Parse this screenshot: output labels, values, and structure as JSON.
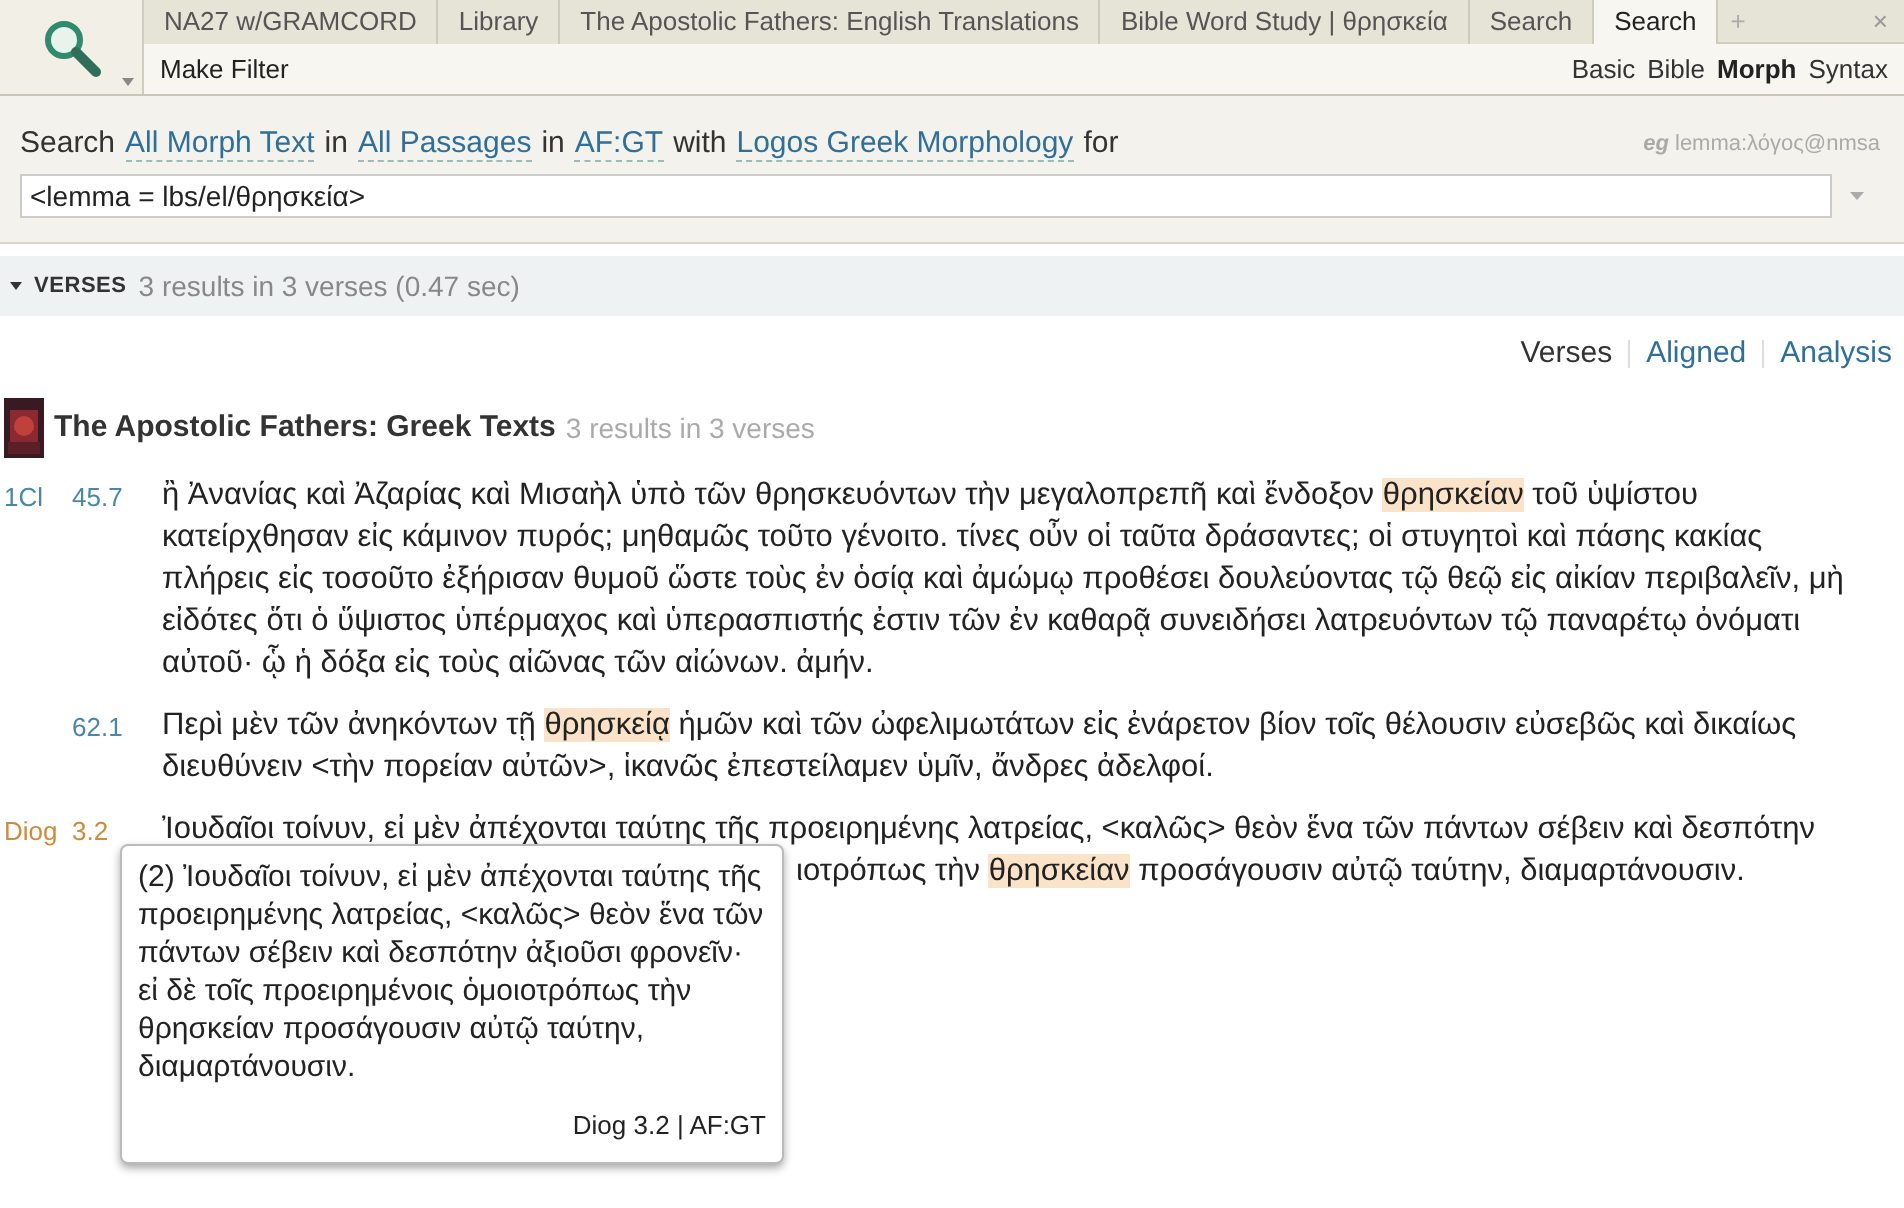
{
  "tabs": [
    {
      "label": "NA27 w/GRAMCORD",
      "selected": false
    },
    {
      "label": "Library",
      "selected": false
    },
    {
      "label": "The Apostolic Fathers: English Translations",
      "selected": false
    },
    {
      "label": "Bible Word Study | θρησκεία",
      "selected": false
    },
    {
      "label": "Search",
      "selected": false
    },
    {
      "label": "Search",
      "selected": true
    }
  ],
  "new_tab": "+",
  "close": "×",
  "toolbar": {
    "make_filter": "Make Filter",
    "modes": [
      {
        "label": "Basic",
        "selected": false
      },
      {
        "label": "Bible",
        "selected": false
      },
      {
        "label": "Morph",
        "selected": true
      },
      {
        "label": "Syntax",
        "selected": false
      }
    ]
  },
  "search_line": [
    {
      "kind": "text",
      "text": "Search"
    },
    {
      "kind": "link",
      "text": "All Morph Text"
    },
    {
      "kind": "text",
      "text": "in"
    },
    {
      "kind": "link",
      "text": "All Passages"
    },
    {
      "kind": "text",
      "text": "in"
    },
    {
      "kind": "link",
      "text": "AF:GT"
    },
    {
      "kind": "text",
      "text": "with"
    },
    {
      "kind": "link",
      "text": "Logos Greek Morphology"
    },
    {
      "kind": "text",
      "text": "for"
    }
  ],
  "example_hint": {
    "prefix": "eg",
    "text": "lemma:λόγος@nmsa"
  },
  "query": "<lemma = lbs/el/θρησκεία>",
  "results_header": {
    "expanded": true,
    "label": "VERSES",
    "summary": "3 results in 3 verses (0.47 sec)"
  },
  "views": [
    {
      "label": "Verses",
      "selected": true
    },
    {
      "label": "Aligned",
      "selected": false
    },
    {
      "label": "Analysis",
      "selected": false
    }
  ],
  "book": {
    "title": "The Apostolic Fathers: Greek Texts",
    "summary": "3 results in 3 verses"
  },
  "verses": [
    {
      "book": "1Cl",
      "ref": "45.7",
      "color": "#4a86a8",
      "lines": [
        [
          {
            "text": "ἢ Ἀνανίας καὶ Ἀζαρίας καὶ Μισαὴλ ὑπὸ τῶν θρησκευόντων τὴν μεγαλοπρεπῆ καὶ ἔνδοξον ",
            "highlight": false
          },
          {
            "text": "θρησκείαν",
            "highlight": true
          },
          {
            "text": " τοῦ ὑψίστου",
            "highlight": false
          }
        ],
        [
          {
            "text": "κατείρχθησαν εἰς κάμινον πυρός; μηθαμῶς τοῦτο γένοιτο. τίνες οὖν οἱ ταῦτα δράσαντες; οἱ στυγητοὶ καὶ πάσης κακίας",
            "highlight": false
          }
        ],
        [
          {
            "text": "πλήρεις εἰς τοσοῦτο ἐξήρισαν θυμοῦ ὥστε τοὺς ἐν ὁσίᾳ καὶ ἀμώμῳ προθέσει δουλεύοντας τῷ θεῷ εἰς αἰκίαν περιβαλεῖν, μὴ",
            "highlight": false
          }
        ],
        [
          {
            "text": "εἰδότες ὅτι ὁ ὕψιστος ὑπέρμαχος καὶ ὑπερασπιστής ἐστιν τῶν ἐν καθαρᾷ συνειδήσει λατρευόντων τῷ παναρέτῳ ὀνόματι",
            "highlight": false
          }
        ],
        [
          {
            "text": "αὐτοῦ· ᾧ ἡ δόξα εἰς τοὺς αἰῶνας τῶν αἰώνων. ἀμήν.",
            "highlight": false
          }
        ]
      ]
    },
    {
      "ref": "62.1",
      "color": "#4a86a8",
      "lines": [
        [
          {
            "text": "Περὶ μὲν τῶν ἀνηκόντων τῇ ",
            "highlight": false
          },
          {
            "text": "θρησκείᾳ",
            "highlight": true
          },
          {
            "text": " ἡμῶν καὶ τῶν ὠφελιμωτάτων εἰς ἐνάρετον βίον τοῖς θέλουσιν εὐσεβῶς καὶ δικαίως",
            "highlight": false
          }
        ],
        [
          {
            "text": "διευθύνειν <τὴν πορείαν αὐτῶν>, ἱκανῶς ἐπεστείλαμεν ὑμῖν, ἄνδρες ἀδελφοί.",
            "highlight": false
          }
        ]
      ]
    },
    {
      "book": "Diog",
      "ref": "3.2",
      "color": "#d08a3a",
      "lines": [
        [
          {
            "text": "Ἰουδαῖοι τοίνυν, εἰ μὲν ἀπέχονται ταύτης τῆς προειρημένης λατρείας, <καλῶς> θεὸν ἕνα τῶν πάντων σέβειν καὶ δεσπότην",
            "highlight": false
          }
        ],
        [
          {
            "text": "ιοτρόπως τὴν ",
            "highlight": false
          },
          {
            "text": "θρησκείαν",
            "highlight": true
          },
          {
            "text": " προσάγουσιν αὐτῷ ταύτην, διαμαρτάνουσιν.",
            "highlight": false
          }
        ]
      ]
    }
  ],
  "tooltip": {
    "text": "(2) Ἰουδαῖοι τοίνυν, εἰ μὲν ἀπέχονται ταύτης τῆς προειρημένης λατρείας, <καλῶς> θεὸν ἕνα τῶν πάντων σέβειν καὶ δεσπότην ἀξιοῦσι φρονεῖν· εἰ δὲ τοῖς προειρημένοις ὁμοιοτρόπως τὴν θρησκείαν προσάγουσιν αὐτῷ ταύτην, διαμαρτάνουσιν.",
    "reference": "Diog 3.2 | AF:GT"
  }
}
